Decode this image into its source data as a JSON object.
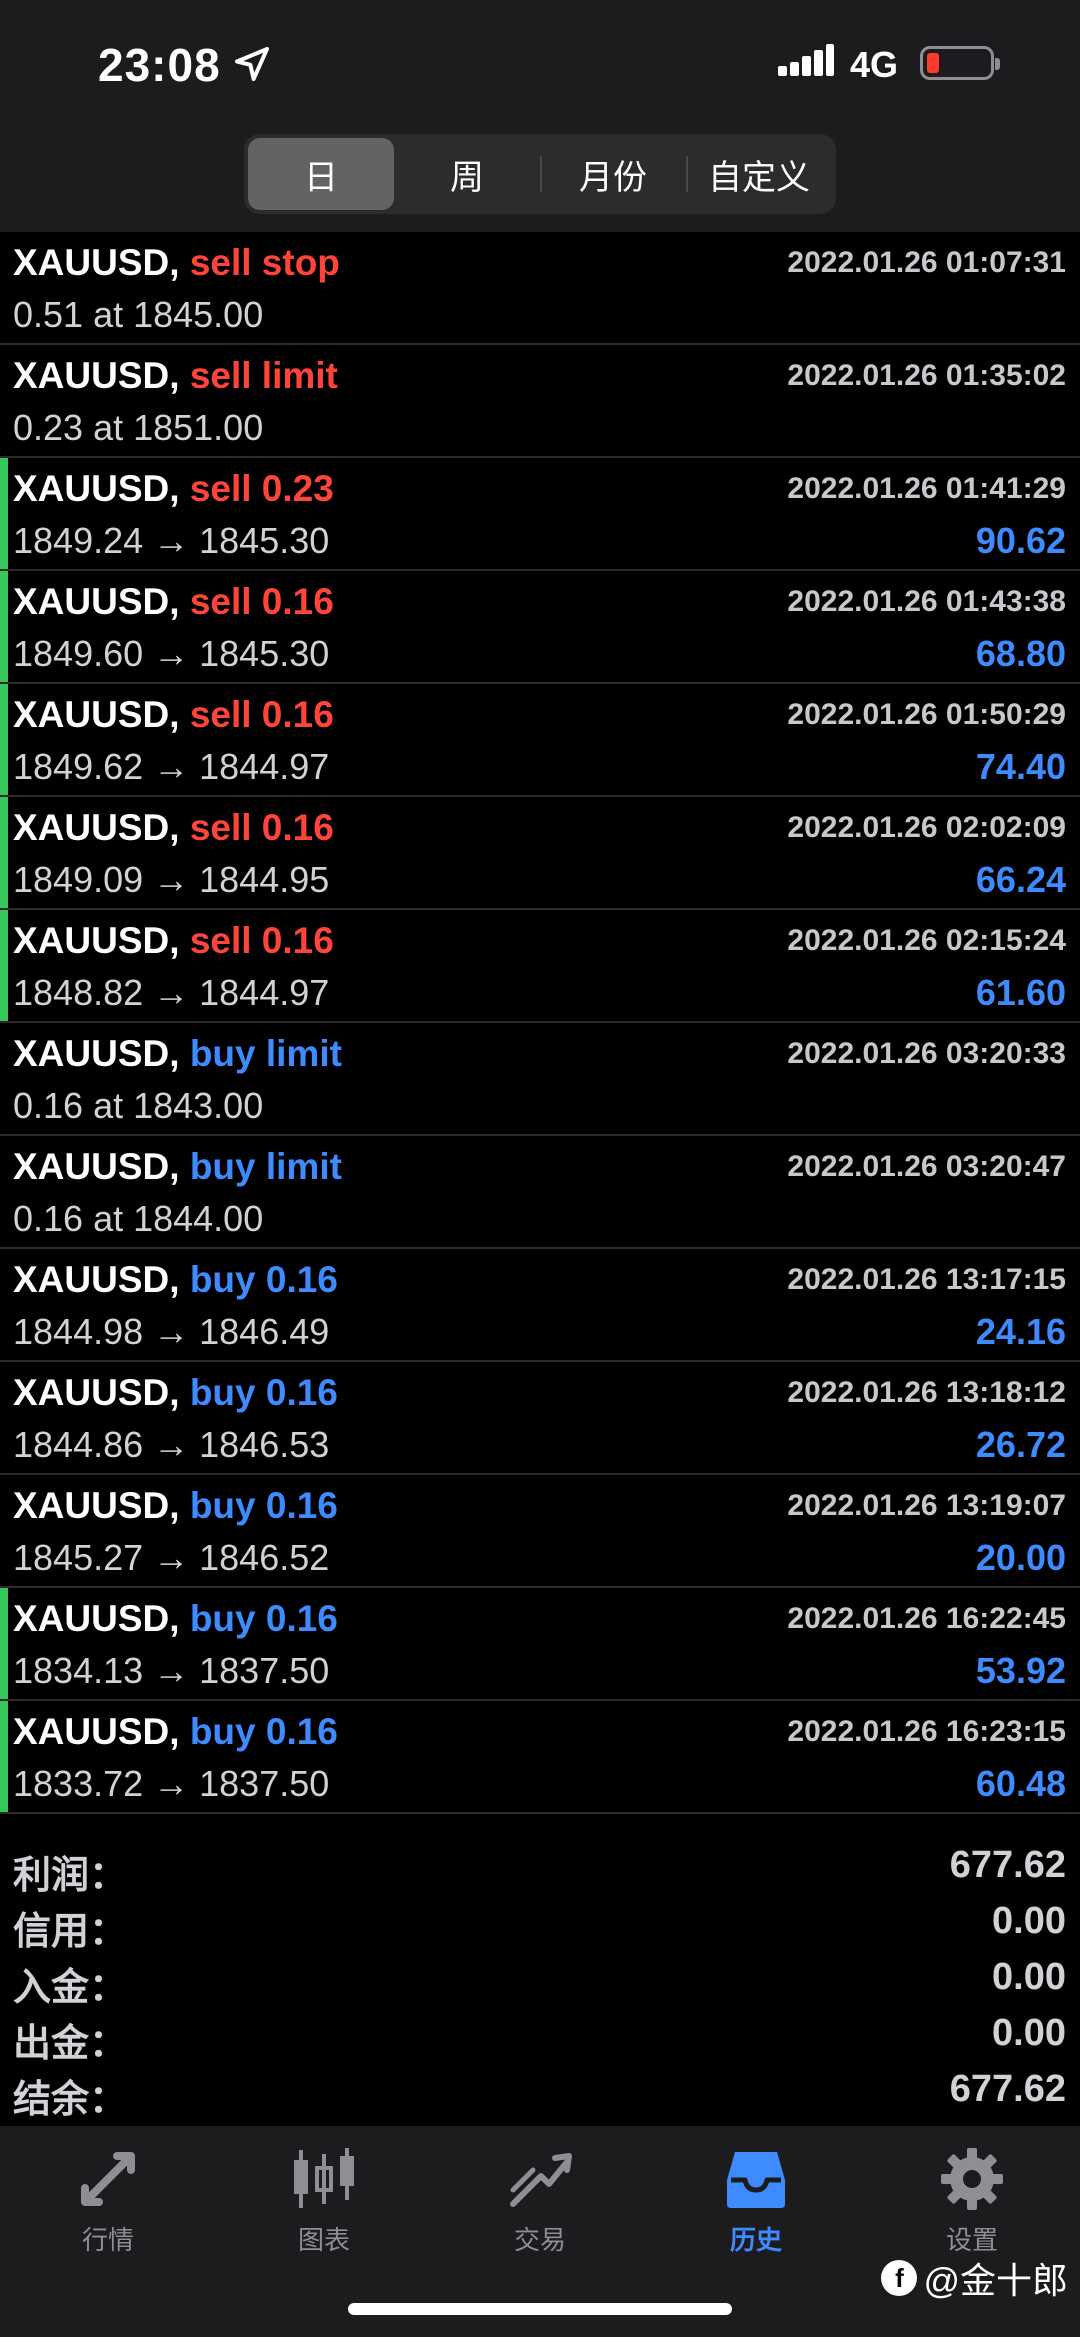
{
  "status": {
    "time": "23:08",
    "network": "4G"
  },
  "segments": [
    "日",
    "周",
    "月份",
    "自定义"
  ],
  "rows": [
    {
      "symbol": "XAUUSD,",
      "action": "sell stop",
      "side": "sell",
      "time": "2022.01.26 01:07:31",
      "detail": "0.51 at 1845.00",
      "profit": "",
      "bar": false
    },
    {
      "symbol": "XAUUSD,",
      "action": "sell limit",
      "side": "sell",
      "time": "2022.01.26 01:35:02",
      "detail": "0.23 at 1851.00",
      "profit": "",
      "bar": false
    },
    {
      "symbol": "XAUUSD,",
      "action": "sell 0.23",
      "side": "sell",
      "time": "2022.01.26 01:41:29",
      "detail": "1849.24 → 1845.30",
      "profit": "90.62",
      "bar": true
    },
    {
      "symbol": "XAUUSD,",
      "action": "sell 0.16",
      "side": "sell",
      "time": "2022.01.26 01:43:38",
      "detail": "1849.60 → 1845.30",
      "profit": "68.80",
      "bar": true
    },
    {
      "symbol": "XAUUSD,",
      "action": "sell 0.16",
      "side": "sell",
      "time": "2022.01.26 01:50:29",
      "detail": "1849.62 → 1844.97",
      "profit": "74.40",
      "bar": true
    },
    {
      "symbol": "XAUUSD,",
      "action": "sell 0.16",
      "side": "sell",
      "time": "2022.01.26 02:02:09",
      "detail": "1849.09 → 1844.95",
      "profit": "66.24",
      "bar": true
    },
    {
      "symbol": "XAUUSD,",
      "action": "sell 0.16",
      "side": "sell",
      "time": "2022.01.26 02:15:24",
      "detail": "1848.82 → 1844.97",
      "profit": "61.60",
      "bar": true
    },
    {
      "symbol": "XAUUSD,",
      "action": "buy limit",
      "side": "buy",
      "time": "2022.01.26 03:20:33",
      "detail": "0.16 at 1843.00",
      "profit": "",
      "bar": false
    },
    {
      "symbol": "XAUUSD,",
      "action": "buy limit",
      "side": "buy",
      "time": "2022.01.26 03:20:47",
      "detail": "0.16 at 1844.00",
      "profit": "",
      "bar": false
    },
    {
      "symbol": "XAUUSD,",
      "action": "buy 0.16",
      "side": "buy",
      "time": "2022.01.26 13:17:15",
      "detail": "1844.98 → 1846.49",
      "profit": "24.16",
      "bar": false
    },
    {
      "symbol": "XAUUSD,",
      "action": "buy 0.16",
      "side": "buy",
      "time": "2022.01.26 13:18:12",
      "detail": "1844.86 → 1846.53",
      "profit": "26.72",
      "bar": false
    },
    {
      "symbol": "XAUUSD,",
      "action": "buy 0.16",
      "side": "buy",
      "time": "2022.01.26 13:19:07",
      "detail": "1845.27 → 1846.52",
      "profit": "20.00",
      "bar": false
    },
    {
      "symbol": "XAUUSD,",
      "action": "buy 0.16",
      "side": "buy",
      "time": "2022.01.26 16:22:45",
      "detail": "1834.13 → 1837.50",
      "profit": "53.92",
      "bar": true
    },
    {
      "symbol": "XAUUSD,",
      "action": "buy 0.16",
      "side": "buy",
      "time": "2022.01.26 16:23:15",
      "detail": "1833.72 → 1837.50",
      "profit": "60.48",
      "bar": true
    }
  ],
  "summary": [
    {
      "label": "利润：",
      "value": "677.62"
    },
    {
      "label": "信用：",
      "value": "0.00"
    },
    {
      "label": "入金：",
      "value": "0.00"
    },
    {
      "label": "出金：",
      "value": "0.00"
    },
    {
      "label": "结余：",
      "value": "677.62"
    }
  ],
  "tabs": [
    {
      "label": "行情",
      "icon": "quotes-icon"
    },
    {
      "label": "图表",
      "icon": "candlestick-chart-icon"
    },
    {
      "label": "交易",
      "icon": "trade-icon"
    },
    {
      "label": "历史",
      "icon": "history-inbox-icon"
    },
    {
      "label": "设置",
      "icon": "gear-icon"
    }
  ],
  "watermark": "@金十郎",
  "colors": {
    "sell": "#ff453a",
    "buy": "#3d8bff",
    "profit": "#3d8bff",
    "active_tab": "#3d8bff",
    "bar": "#34c759"
  }
}
